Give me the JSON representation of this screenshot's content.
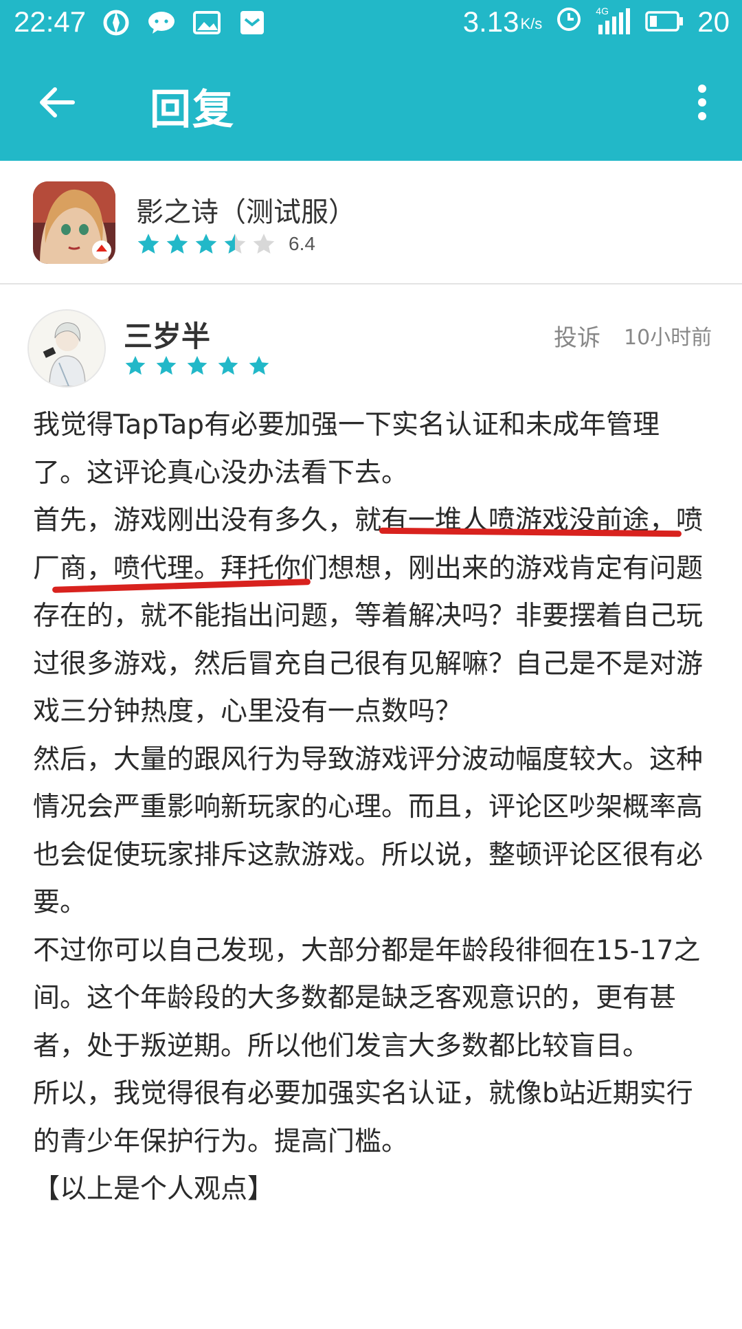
{
  "status_bar": {
    "time": "22:47",
    "speed": "3.13",
    "speed_unit": "K/s",
    "network": "4G",
    "battery": "20"
  },
  "app_bar": {
    "title": "回复",
    "back_icon": "arrow-left-icon",
    "menu_icon": "more-vert-icon"
  },
  "game": {
    "name": "影之诗（测试服）",
    "score": "6.4",
    "stars": 3.5
  },
  "review": {
    "username": "三岁半",
    "stars": 5,
    "report_label": "投诉",
    "time": "10小时前",
    "paragraphs": [
      "我觉得TapTap有必要加强一下实名认证和未成年管理了。这评论真心没办法看下去。",
      "首先，游戏刚出没有多久，就有一堆人喷游戏没前途，喷厂商，喷代理。拜托你们想想，刚出来的游戏肯定有问题存在的，就不能指出问题，等着解决吗？非要摆着自己玩过很多游戏，然后冒充自己很有见解嘛？自己是不是对游戏三分钟热度，心里没有一点数吗？",
      "然后，大量的跟风行为导致游戏评分波动幅度较大。这种情况会严重影响新玩家的心理。而且，评论区吵架概率高也会促使玩家排斥这款游戏。所以说，整顿评论区很有必要。",
      "不过你可以自己发现，大部分都是年龄段徘徊在15-17之间。这个年龄段的大多数都是缺乏客观意识的，更有甚者，处于叛逆期。所以他们发言大多数都比较盲目。",
      "所以，我觉得很有必要加强实名认证，就像b站近期实行的青少年保护行为。提高门槛。",
      "【以上是个人观点】"
    ]
  },
  "colors": {
    "accent": "#22b8c8",
    "star": "#22b8c8",
    "star_empty": "#d8d8d8",
    "annotation": "#d8221e"
  }
}
